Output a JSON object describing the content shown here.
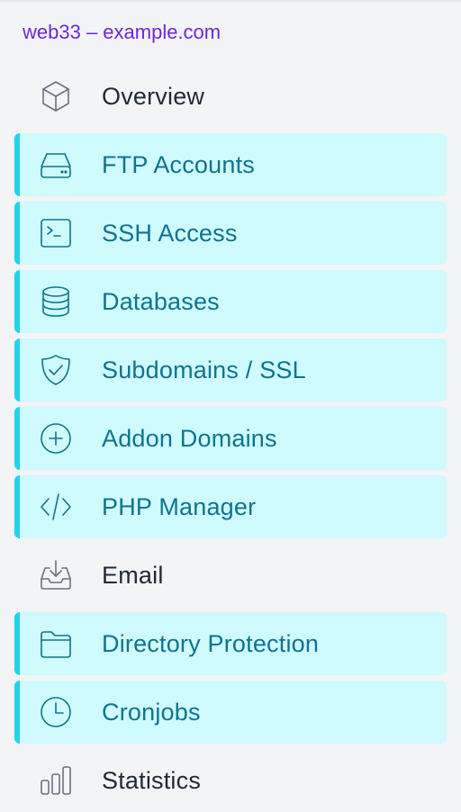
{
  "header": {
    "site_label": "web33 – example.com"
  },
  "colors": {
    "site_link": "#6d28d9",
    "active_bg": "#cffafe",
    "active_accent": "#22d3ee",
    "active_text": "#0e7490",
    "inactive_text": "#1f2937",
    "inactive_icon": "#6b7280",
    "page_bg": "#f3f4f6"
  },
  "menu": {
    "items": [
      {
        "label": "Overview",
        "icon": "cube-icon",
        "active": false
      },
      {
        "label": "FTP Accounts",
        "icon": "hard-drive-icon",
        "active": true
      },
      {
        "label": "SSH Access",
        "icon": "terminal-icon",
        "active": true
      },
      {
        "label": "Databases",
        "icon": "database-icon",
        "active": true
      },
      {
        "label": "Subdomains / SSL",
        "icon": "shield-check-icon",
        "active": true
      },
      {
        "label": "Addon Domains",
        "icon": "plus-circle-icon",
        "active": true
      },
      {
        "label": "PHP Manager",
        "icon": "code-icon",
        "active": true
      },
      {
        "label": "Email",
        "icon": "inbox-download-icon",
        "active": false
      },
      {
        "label": "Directory Protection",
        "icon": "folder-icon",
        "active": true
      },
      {
        "label": "Cronjobs",
        "icon": "clock-icon",
        "active": true
      },
      {
        "label": "Statistics",
        "icon": "bar-chart-icon",
        "active": false
      }
    ]
  }
}
